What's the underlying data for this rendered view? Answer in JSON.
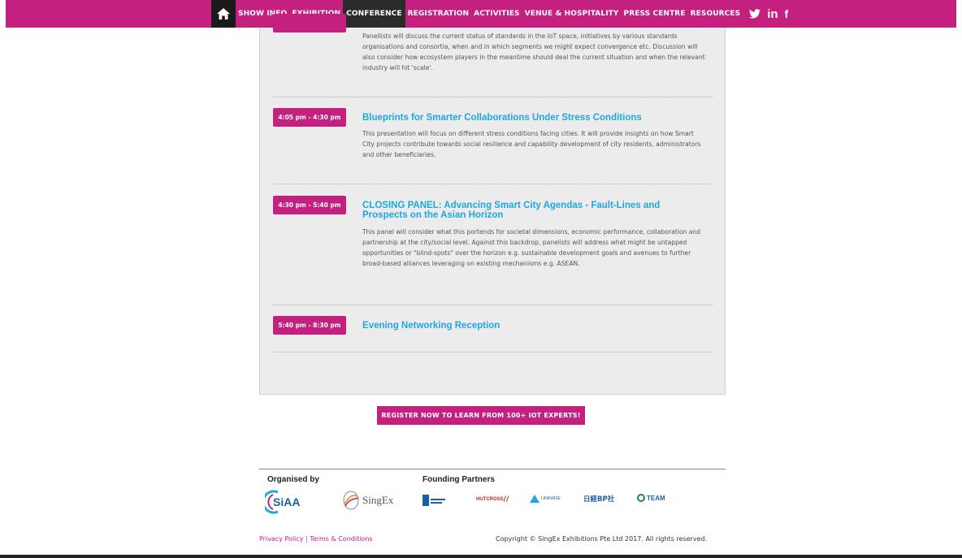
{
  "nav": {
    "items": [
      "SHOW INFO",
      "EXHIBITION",
      "CONFERENCE",
      "REGISTRATION",
      "ACTIVITIES",
      "VENUE & HOSPITALITY",
      "PRESS CENTRE",
      "RESOURCES"
    ],
    "active": "CONFERENCE",
    "linkedin_text": "in",
    "facebook_text": "f"
  },
  "agenda": {
    "top_desc": "Panellists will discuss the current status of standards in the IoT space, initiatives by various standards organisations and consortia, when and in which segments we might expect convergence etc. Discussion will also consider how ecosystem players in the meantime should deal the current situation and when the relevant industry will hit 'scale'.",
    "items": [
      {
        "time": "4:05 pm - 4:30 pm",
        "title": "Blueprints for Smarter Collaborations Under Stress Conditions",
        "desc": "This presentation will focus on different stress conditions facing cities. It will provide insights on how Smart City projects contribute towards social resilience and capability development of city residents, administrators and other beneficiaries."
      },
      {
        "time": "4:30 pm - 5:40 pm",
        "title": "CLOSING PANEL: Advancing Smart City Agendas - Fault-Lines and Prospects on the Asian Horizon",
        "desc": "This panel will consider what this portends for societal dimensions, economic performance, collaboration and partnership at the city/social level.  Against this backdrop, panelists will address what might be untapped opportunities or \"blind-spots\" over the horizon e.g. sustainable development goals and avenues to further broad-based alliances leveraging on existing mechanisms e.g. ASEAN."
      },
      {
        "time": "5:40 pm - 8:30 pm",
        "title": "Evening Networking Reception",
        "desc": ""
      }
    ]
  },
  "register_label": "REGISTER NOW TO LEARN FROM 100+ IOT EXPERTS!",
  "footer": {
    "organised_by": "Organised by",
    "founding_partners": "Founding Partners",
    "logos": {
      "siaa": "SiAA",
      "singex": "SingEx",
      "hutcross": "HUTCROSS",
      "linkwise": "LINKWISE",
      "nikkei": "日経BP社",
      "team": "TEAM"
    },
    "privacy": "Privacy Policy",
    "separator": "|",
    "terms": "Terms & Conditions",
    "copyright": "Copyright © SingEx Exhibitions Pte Ltd 2017.  All rights reserved."
  },
  "colors": {
    "brand": "#c3207f",
    "title_blue": "#1ea7e1"
  },
  "icons": [
    "home-icon",
    "twitter-icon",
    "linkedin-icon",
    "facebook-icon"
  ]
}
